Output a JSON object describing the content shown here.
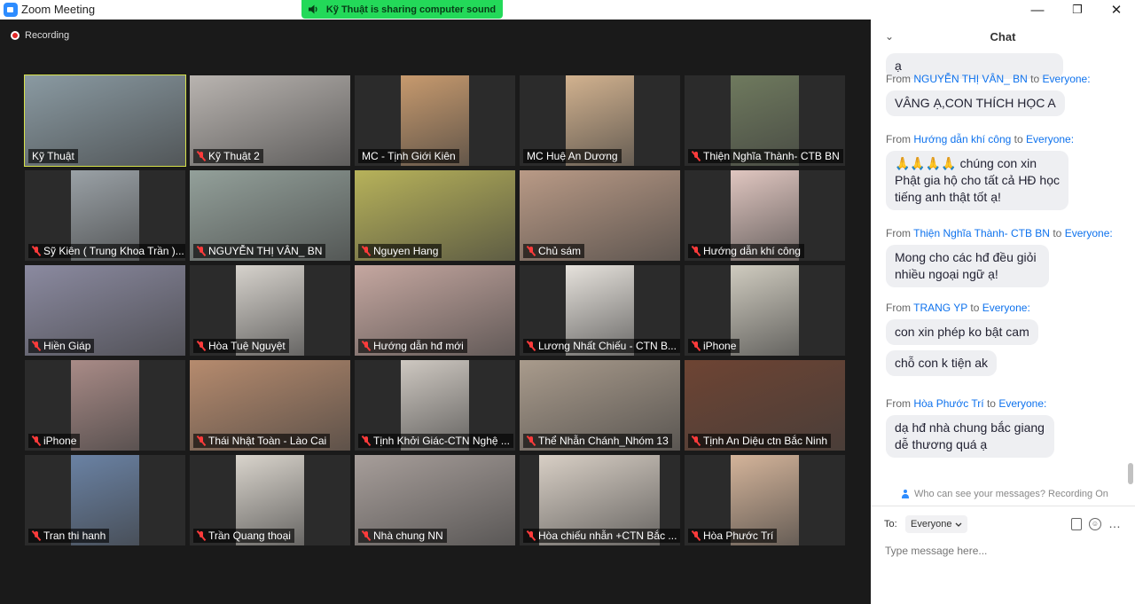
{
  "window": {
    "title": "Zoom Meeting",
    "minimize": "—",
    "maximize": "❐",
    "close": "✕"
  },
  "share_banner": {
    "text": "Kỹ Thuật is sharing computer sound"
  },
  "recording": {
    "label": "Recording"
  },
  "participants": [
    {
      "name": "Kỹ Thuật",
      "muted": false,
      "active": true
    },
    {
      "name": "Kỹ Thuật 2",
      "muted": true
    },
    {
      "name": "MC - Tịnh Giới Kiên",
      "muted": false
    },
    {
      "name": "MC Huệ An Dương",
      "muted": false
    },
    {
      "name": "Thiện Nghĩa Thành- CTB BN",
      "muted": true
    },
    {
      "name": "Sỹ Kiên ( Trung Khoa Trần )...",
      "muted": true
    },
    {
      "name": "NGUYỄN THỊ VÂN_ BN",
      "muted": true
    },
    {
      "name": "Nguyen Hang",
      "muted": true
    },
    {
      "name": "Chủ sám",
      "muted": true
    },
    {
      "name": "Hướng dẫn khí công",
      "muted": true
    },
    {
      "name": "Hiền Giáp",
      "muted": true
    },
    {
      "name": "Hòa Tuệ Nguyệt",
      "muted": true
    },
    {
      "name": "Hướng dẫn hđ mới",
      "muted": true
    },
    {
      "name": "Lương Nhất Chiếu - CTN B...",
      "muted": true
    },
    {
      "name": "iPhone",
      "muted": true
    },
    {
      "name": "iPhone",
      "muted": true
    },
    {
      "name": "Thái Nhật Toàn - Lào Cai",
      "muted": true
    },
    {
      "name": "Tịnh Khởi Giác-CTN Nghệ ...",
      "muted": true
    },
    {
      "name": "Thể Nhẫn Chánh_Nhóm 13",
      "muted": true
    },
    {
      "name": "Tịnh An Diệu ctn Bắc Ninh",
      "muted": true
    },
    {
      "name": "Tran thi hanh",
      "muted": true
    },
    {
      "name": "Trần Quang thoại",
      "muted": true
    },
    {
      "name": "Nhà chung NN",
      "muted": true
    },
    {
      "name": "Hòa chiếu nhẫn +CTN Bắc ...",
      "muted": true
    },
    {
      "name": "Hòa Phước Trí",
      "muted": true
    }
  ],
  "chat": {
    "title": "Chat",
    "collapse_icon": "⌄",
    "messages": [
      {
        "from_label": "",
        "sender": "",
        "to_label": "",
        "recipient": "",
        "bubbles": [
          "ạ"
        ]
      },
      {
        "from_label": "From",
        "sender": "NGUYỄN THỊ VÂN_ BN",
        "to_label": "to",
        "recipient": "Everyone:",
        "bubbles": [
          "VÂNG Ạ,CON THÍCH HỌC A"
        ]
      },
      {
        "from_label": "From",
        "sender": "Hướng dẫn khí công",
        "to_label": "to",
        "recipient": "Everyone:",
        "bubbles": [
          "🙏🙏🙏🙏 chúng con xin Phật gia hộ cho tất cả HĐ học tiếng anh thật tốt ạ!"
        ]
      },
      {
        "from_label": "From",
        "sender": "Thiện Nghĩa Thành- CTB BN",
        "to_label": "to",
        "recipient": "Everyone:",
        "bubbles": [
          "Mong cho các hđ đều giỏi nhiều ngoại ngữ ạ!"
        ]
      },
      {
        "from_label": "From",
        "sender": "TRANG YP",
        "to_label": "to",
        "recipient": "Everyone:",
        "bubbles": [
          "con xin phép ko bật cam",
          "chỗ con k tiện ak"
        ]
      },
      {
        "from_label": "From",
        "sender": "Hòa Phước Trí",
        "to_label": "to",
        "recipient": "Everyone:",
        "bubbles": [
          "dạ hđ nhà chung bắc giang dễ thương quá ạ"
        ]
      }
    ],
    "who_can_see": "Who can see your messages? Recording On",
    "to_label": "To:",
    "to_value": "Everyone",
    "input_placeholder": "Type message here...",
    "more_icon": "…"
  }
}
